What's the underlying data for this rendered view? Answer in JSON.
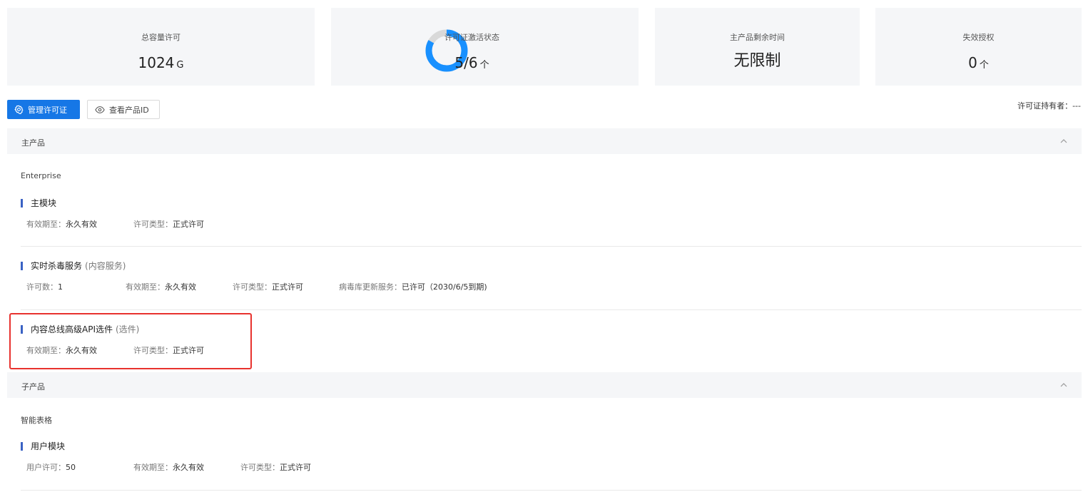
{
  "stats": {
    "total_capacity": {
      "title": "总容量许可",
      "value": "1024",
      "unit": "G"
    },
    "activation": {
      "title": "许可证激活状态",
      "value": "5/6",
      "unit": "个",
      "progress": 0.833
    },
    "remaining_time": {
      "title": "主产品剩余时间",
      "value": "无限制"
    },
    "invalid": {
      "title": "失效授权",
      "value": "0",
      "unit": "个"
    }
  },
  "toolbar": {
    "manage_label": "管理许可证",
    "view_id_label": "查看产品ID",
    "holder_label": "许可证持有者：",
    "holder_value": "---"
  },
  "main_product": {
    "header": "主产品",
    "name": "Enterprise",
    "modules": [
      {
        "title": "主模块",
        "meta": [
          {
            "label": "有效期至：",
            "value": "永久有效"
          },
          {
            "label": "许可类型：",
            "value": "正式许可"
          }
        ]
      },
      {
        "title": "实时杀毒服务",
        "subtitle": "(内容服务)",
        "meta": [
          {
            "label": "许可数：",
            "value": "1"
          },
          {
            "label": "有效期至：",
            "value": "永久有效"
          },
          {
            "label": "许可类型：",
            "value": "正式许可"
          },
          {
            "label": "病毒库更新服务：",
            "value": "已许可（2030/6/5到期)"
          }
        ]
      },
      {
        "title": "内容总线高级API选件",
        "subtitle": "(选件)",
        "meta": [
          {
            "label": "有效期至：",
            "value": "永久有效"
          },
          {
            "label": "许可类型：",
            "value": "正式许可"
          }
        ]
      }
    ]
  },
  "sub_product": {
    "header": "子产品",
    "name": "智能表格",
    "modules": [
      {
        "title": "用户模块",
        "meta": [
          {
            "label": "用户许可：",
            "value": "50"
          },
          {
            "label": "有效期至：",
            "value": "永久有效"
          },
          {
            "label": "许可类型：",
            "value": "正式许可"
          }
        ]
      }
    ]
  },
  "icons": {
    "manage": "gear-icon",
    "view": "eye-icon",
    "collapse": "chevron-up-icon"
  },
  "colors": {
    "primary": "#1677e6",
    "donut": "#1890ff",
    "donut_track": "#d9d9d9",
    "module_bar": "#3a62c4",
    "highlight": "#e8322e"
  }
}
